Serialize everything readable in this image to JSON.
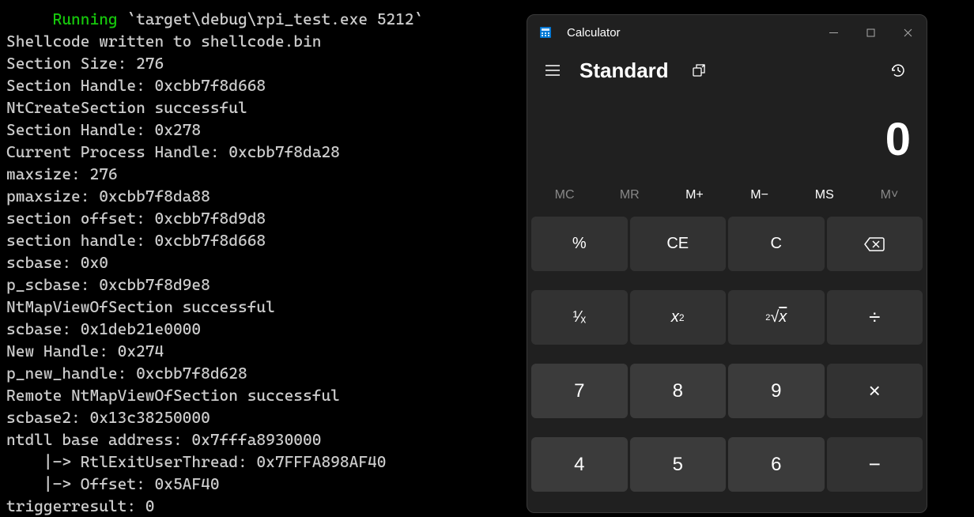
{
  "terminal": {
    "running_label": "Running",
    "command": "`target\\debug\\rpi_test.exe 5212`",
    "lines": [
      "Shellcode written to shellcode.bin",
      "Section Size: 276",
      "Section Handle: 0xcbb7f8d668",
      "NtCreateSection successful",
      "Section Handle: 0x278",
      "Current Process Handle: 0xcbb7f8da28",
      "maxsize: 276",
      "pmaxsize: 0xcbb7f8da88",
      "section offset: 0xcbb7f8d9d8",
      "section handle: 0xcbb7f8d668",
      "scbase: 0x0",
      "p_scbase: 0xcbb7f8d9e8",
      "NtMapViewOfSection successful",
      "scbase: 0x1deb21e0000",
      "New Handle: 0x274",
      "p_new_handle: 0xcbb7f8d628",
      "Remote NtMapViewOfSection successful",
      "scbase2: 0x13c38250000",
      "ntdll base address: 0x7fffa8930000",
      "    |-> RtlExitUserThread: 0x7FFFA898AF40",
      "    |-> Offset: 0x5AF40",
      "triggerresult: 0"
    ]
  },
  "calculator": {
    "title": "Calculator",
    "mode": "Standard",
    "display": "0",
    "memory": {
      "mc": "MC",
      "mr": "MR",
      "mplus": "M+",
      "mminus": "M−",
      "ms": "MS",
      "mlist": "M˅"
    },
    "keys": {
      "percent": "%",
      "ce": "CE",
      "c": "C",
      "reciprocal": "¹⁄ₓ",
      "square": "x²",
      "sqrt": "²√x",
      "divide": "÷",
      "seven": "7",
      "eight": "8",
      "nine": "9",
      "multiply": "×",
      "four": "4",
      "five": "5",
      "six": "6",
      "minus": "−"
    }
  }
}
